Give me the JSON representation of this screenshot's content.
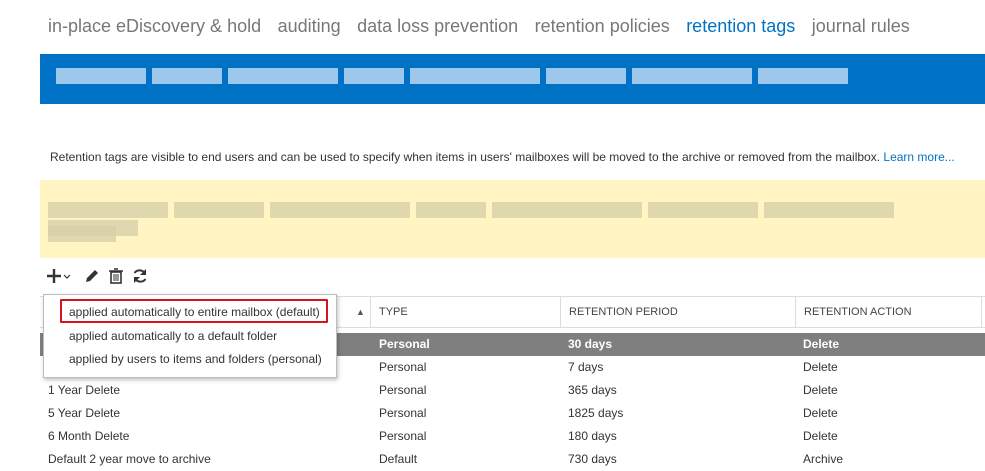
{
  "nav": {
    "tabs": [
      {
        "label": "in-place eDiscovery & hold",
        "active": false
      },
      {
        "label": "auditing",
        "active": false
      },
      {
        "label": "data loss prevention",
        "active": false
      },
      {
        "label": "retention policies",
        "active": false
      },
      {
        "label": "retention tags",
        "active": true
      },
      {
        "label": "journal rules",
        "active": false
      }
    ]
  },
  "description": {
    "text": "Retention tags are visible to end users and can be used to specify when items in users' mailboxes will be moved to the archive or removed from the mailbox.",
    "link": "Learn more..."
  },
  "toolbar": {
    "icons": [
      "add-icon",
      "dropdown-caret-icon",
      "edit-icon",
      "delete-icon",
      "refresh-icon"
    ]
  },
  "new_menu": {
    "items": [
      "applied automatically to entire mailbox (default)",
      "applied automatically to a default folder",
      "applied by users to items and folders (personal)"
    ]
  },
  "table": {
    "columns": [
      "TYPE",
      "RETENTION PERIOD",
      "RETENTION ACTION"
    ],
    "rows": [
      {
        "name": "",
        "type": "Personal",
        "period": "30 days",
        "action": "Delete",
        "selected": true
      },
      {
        "name": "",
        "type": "Personal",
        "period": "7 days",
        "action": "Delete",
        "selected": false
      },
      {
        "name": "1 Year Delete",
        "type": "Personal",
        "period": "365 days",
        "action": "Delete",
        "selected": false
      },
      {
        "name": "5 Year Delete",
        "type": "Personal",
        "period": "1825 days",
        "action": "Delete",
        "selected": false
      },
      {
        "name": "6 Month Delete",
        "type": "Personal",
        "period": "180 days",
        "action": "Delete",
        "selected": false
      },
      {
        "name": "Default 2 year move to archive",
        "type": "Default",
        "period": "730 days",
        "action": "Archive",
        "selected": false
      }
    ]
  },
  "colors": {
    "accent": "#0072c6",
    "banner": "#0072c6",
    "notice": "#fff4c2",
    "selected_row": "#7f7f7f",
    "highlight": "#d6131f"
  }
}
